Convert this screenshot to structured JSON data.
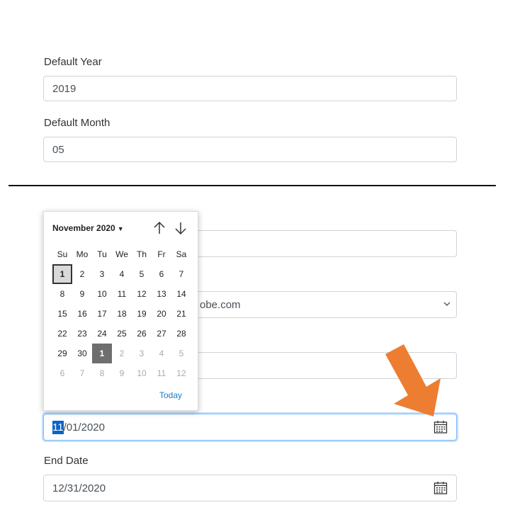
{
  "default_year": {
    "label": "Default Year",
    "value": "2019"
  },
  "default_month": {
    "label": "Default Month",
    "value": "05"
  },
  "partial_fields": {
    "email_value_fragment": "obe.com"
  },
  "start_date": {
    "value_month": "11",
    "value_rest": "/01/2020"
  },
  "end_date": {
    "label": "End Date",
    "value": "12/31/2020"
  },
  "datepicker": {
    "month_label": "November 2020",
    "today_label": "Today",
    "weekdays": [
      "Su",
      "Mo",
      "Tu",
      "We",
      "Th",
      "Fr",
      "Sa"
    ],
    "weeks": [
      [
        "1",
        "2",
        "3",
        "4",
        "5",
        "6",
        "7"
      ],
      [
        "8",
        "9",
        "10",
        "11",
        "12",
        "13",
        "14"
      ],
      [
        "15",
        "16",
        "17",
        "18",
        "19",
        "20",
        "21"
      ],
      [
        "22",
        "23",
        "24",
        "25",
        "26",
        "27",
        "28"
      ],
      [
        "29",
        "30",
        "1",
        "2",
        "3",
        "4",
        "5"
      ],
      [
        "6",
        "7",
        "8",
        "9",
        "10",
        "11",
        "12"
      ]
    ]
  },
  "colors": {
    "annotation_arrow": "#ed7d31",
    "selection": "#0a64c8",
    "link": "#1a7ccc"
  },
  "icons": [
    "caret-down-icon",
    "arrow-up-icon",
    "arrow-down-icon",
    "chevron-down-icon",
    "calendar-icon",
    "annotation-arrow"
  ]
}
